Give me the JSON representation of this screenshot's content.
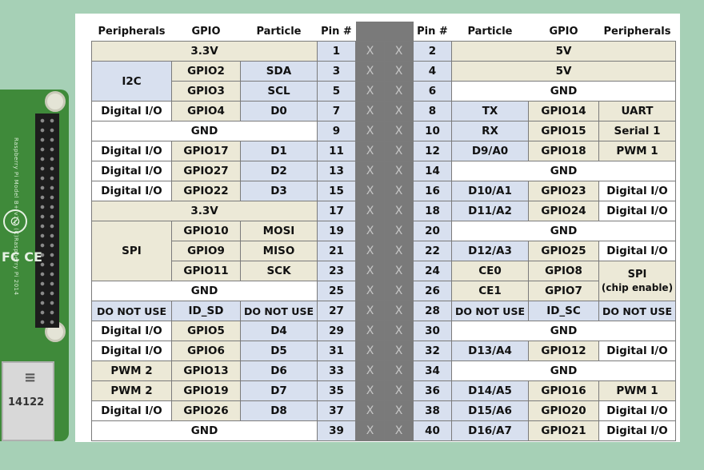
{
  "board": {
    "silk_text": "Raspberry Pi Model B+ v1.2 (C)Raspberry Pi 2014",
    "ethernet_label": "14122"
  },
  "headers": {
    "left_peripherals": "Peripherals",
    "left_gpio": "GPIO",
    "left_particle": "Particle",
    "left_pin": "Pin #",
    "right_pin": "Pin #",
    "right_particle": "Particle",
    "right_gpio": "GPIO",
    "right_peripherals": "Peripherals"
  },
  "x_mark": "X",
  "rows": [
    {
      "pin_left": "1",
      "pin_right": "2",
      "left_span": "3.3V",
      "right_span": "5V"
    },
    {
      "pin_left": "3",
      "pin_right": "4",
      "left_group": "I2C",
      "gpio_left": "GPIO2",
      "particle_left": "SDA",
      "right_span": "5V"
    },
    {
      "pin_left": "5",
      "pin_right": "6",
      "gpio_left": "GPIO3",
      "particle_left": "SCL",
      "right_span": "GND"
    },
    {
      "pin_left": "7",
      "pin_right": "8",
      "periph_left": "Digital I/O",
      "gpio_left": "GPIO4",
      "particle_left": "D0",
      "particle_right": "TX",
      "gpio_right": "GPIO14",
      "periph_right": "UART"
    },
    {
      "pin_left": "9",
      "pin_right": "10",
      "left_span": "GND",
      "particle_right": "RX",
      "gpio_right": "GPIO15",
      "periph_right": "Serial 1"
    },
    {
      "pin_left": "11",
      "pin_right": "12",
      "periph_left": "Digital I/O",
      "gpio_left": "GPIO17",
      "particle_left": "D1",
      "particle_right": "D9/A0",
      "gpio_right": "GPIO18",
      "periph_right": "PWM 1"
    },
    {
      "pin_left": "13",
      "pin_right": "14",
      "periph_left": "Digital I/O",
      "gpio_left": "GPIO27",
      "particle_left": "D2",
      "right_span": "GND"
    },
    {
      "pin_left": "15",
      "pin_right": "16",
      "periph_left": "Digital I/O",
      "gpio_left": "GPIO22",
      "particle_left": "D3",
      "particle_right": "D10/A1",
      "gpio_right": "GPIO23",
      "periph_right": "Digital I/O"
    },
    {
      "pin_left": "17",
      "pin_right": "18",
      "left_span": "3.3V",
      "particle_right": "D11/A2",
      "gpio_right": "GPIO24",
      "periph_right": "Digital I/O"
    },
    {
      "pin_left": "19",
      "pin_right": "20",
      "left_group": "SPI",
      "gpio_left": "GPIO10",
      "particle_left": "MOSI",
      "right_span": "GND"
    },
    {
      "pin_left": "21",
      "pin_right": "22",
      "gpio_left": "GPIO9",
      "particle_left": "MISO",
      "particle_right": "D12/A3",
      "gpio_right": "GPIO25",
      "periph_right": "Digital I/O"
    },
    {
      "pin_left": "23",
      "pin_right": "24",
      "gpio_left": "GPIO11",
      "particle_left": "SCK",
      "particle_right": "CE0",
      "gpio_right": "GPIO8",
      "right_group_line1": "SPI",
      "right_group_line2": "(chip enable)"
    },
    {
      "pin_left": "25",
      "pin_right": "26",
      "left_span": "GND",
      "particle_right": "CE1",
      "gpio_right": "GPIO7"
    },
    {
      "pin_left": "27",
      "pin_right": "28",
      "periph_left": "DO NOT USE",
      "gpio_left": "ID_SD",
      "particle_left": "DO NOT USE",
      "particle_right": "DO NOT USE",
      "gpio_right": "ID_SC",
      "periph_right": "DO NOT USE"
    },
    {
      "pin_left": "29",
      "pin_right": "30",
      "periph_left": "Digital I/O",
      "gpio_left": "GPIO5",
      "particle_left": "D4",
      "right_span": "GND"
    },
    {
      "pin_left": "31",
      "pin_right": "32",
      "periph_left": "Digital I/O",
      "gpio_left": "GPIO6",
      "particle_left": "D5",
      "particle_right": "D13/A4",
      "gpio_right": "GPIO12",
      "periph_right": "Digital I/O"
    },
    {
      "pin_left": "33",
      "pin_right": "34",
      "periph_left": "PWM 2",
      "gpio_left": "GPIO13",
      "particle_left": "D6",
      "right_span": "GND"
    },
    {
      "pin_left": "35",
      "pin_right": "36",
      "periph_left": "PWM 2",
      "gpio_left": "GPIO19",
      "particle_left": "D7",
      "particle_right": "D14/A5",
      "gpio_right": "GPIO16",
      "periph_right": "PWM 1"
    },
    {
      "pin_left": "37",
      "pin_right": "38",
      "periph_left": "Digital I/O",
      "gpio_left": "GPIO26",
      "particle_left": "D8",
      "particle_right": "D15/A6",
      "gpio_right": "GPIO20",
      "periph_right": "Digital I/O"
    },
    {
      "pin_left": "39",
      "pin_right": "40",
      "left_span": "GND",
      "particle_right": "D16/A7",
      "gpio_right": "GPIO21",
      "periph_right": "Digital I/O"
    }
  ]
}
